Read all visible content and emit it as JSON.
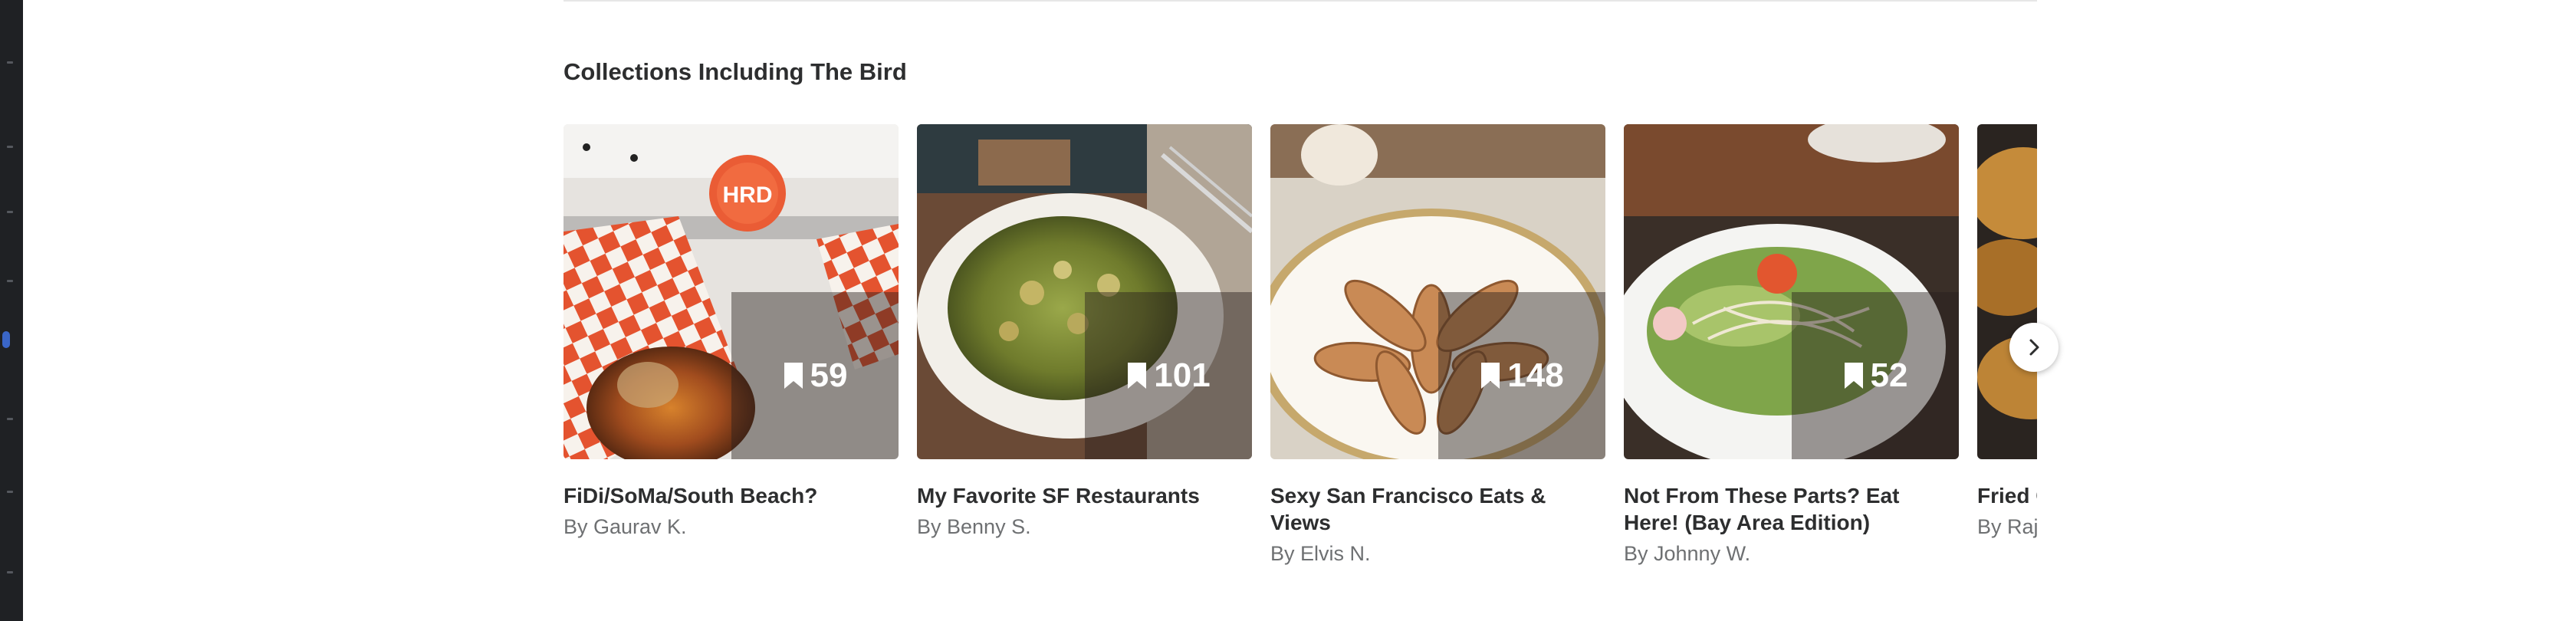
{
  "section": {
    "title": "Collections Including The Bird"
  },
  "collections": [
    {
      "title": "FiDi/SoMa/South Beach?",
      "author": "By Gaurav K.",
      "saves": "59",
      "image": "burrito-in-checkered-paper-photo"
    },
    {
      "title": "My Favorite SF Restaurants",
      "author": "By Benny S.",
      "saves": "101",
      "image": "pesto-gnocchi-plate-photo"
    },
    {
      "title": "Sexy San Francisco Eats & Views",
      "author": "By Elvis N.",
      "saves": "148",
      "image": "chicken-wings-plate-photo"
    },
    {
      "title": "Not From These Parts? Eat Here! (Bay Area Edition)",
      "author": "By Johnny W.",
      "saves": "52",
      "image": "salad-bowl-photo"
    },
    {
      "title": "Fried C",
      "author": "By Raj",
      "saves": "",
      "image": "fried-chicken-photo"
    }
  ],
  "icons": {
    "bookmark": "bookmark-icon",
    "next": "chevron-right-icon"
  }
}
